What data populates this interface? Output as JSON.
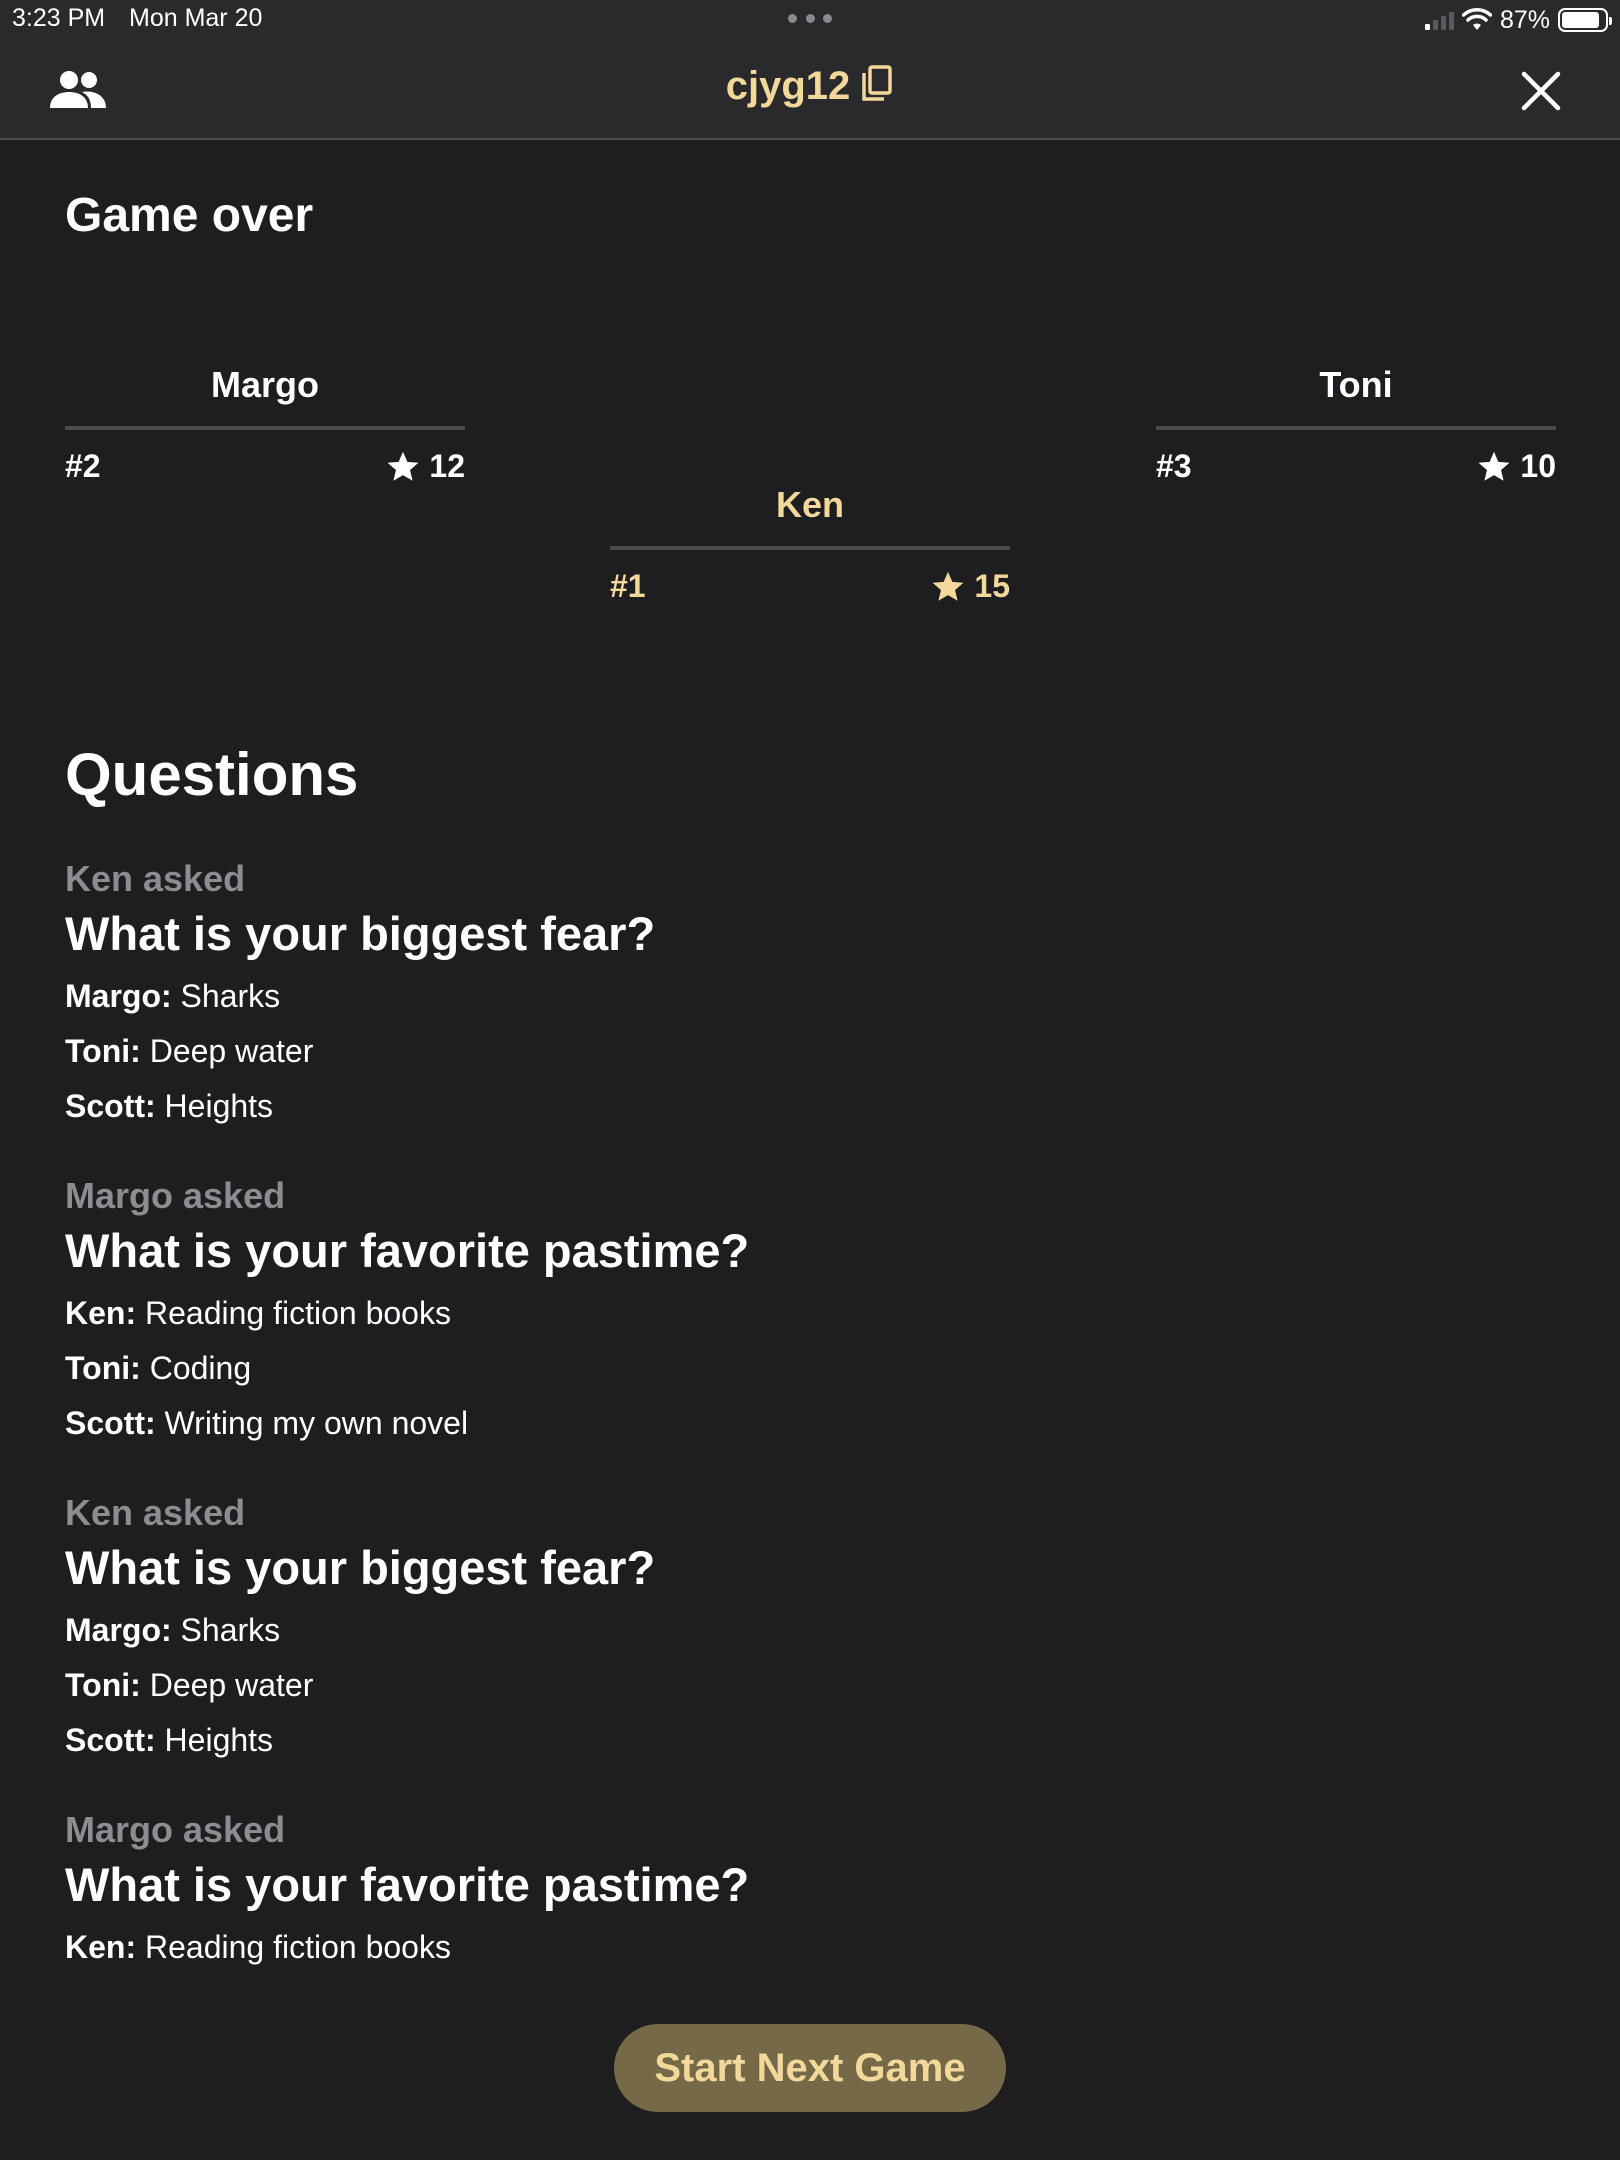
{
  "status_bar": {
    "time": "3:23 PM",
    "date": "Mon Mar 20",
    "battery": "87%",
    "battery_level": 0.87
  },
  "nav": {
    "room_code": "cjyg12",
    "people_icon": "people-icon",
    "copy_icon": "copy-icon",
    "close_icon": "close-icon"
  },
  "page_title": "Game over",
  "leaderboard": [
    {
      "name": "Margo",
      "rank": "#2",
      "score": "12",
      "highlight": false
    },
    {
      "name": "Ken",
      "rank": "#1",
      "score": "15",
      "highlight": true
    },
    {
      "name": "Toni",
      "rank": "#3",
      "score": "10",
      "highlight": false
    }
  ],
  "questions_title": "Questions",
  "questions": [
    {
      "asker": "Ken asked",
      "question": "What is your biggest fear?",
      "answers": [
        {
          "player": "Margo:",
          "answer": "Sharks"
        },
        {
          "player": "Toni:",
          "answer": "Deep water"
        },
        {
          "player": "Scott:",
          "answer": "Heights"
        }
      ]
    },
    {
      "asker": "Margo asked",
      "question": "What is your favorite pastime?",
      "answers": [
        {
          "player": "Ken:",
          "answer": "Reading fiction books"
        },
        {
          "player": "Toni:",
          "answer": "Coding"
        },
        {
          "player": "Scott:",
          "answer": "Writing my own novel"
        }
      ]
    },
    {
      "asker": "Ken asked",
      "question": "What is your biggest fear?",
      "answers": [
        {
          "player": "Margo:",
          "answer": "Sharks"
        },
        {
          "player": "Toni:",
          "answer": "Deep water"
        },
        {
          "player": "Scott:",
          "answer": "Heights"
        }
      ]
    },
    {
      "asker": "Margo asked",
      "question": "What is your favorite pastime?",
      "answers": [
        {
          "player": "Ken:",
          "answer": "Reading fiction books"
        }
      ]
    }
  ],
  "start_button_label": "Start Next Game",
  "colors": {
    "background": "#1e1e20",
    "bar": "#2a2a2c",
    "accent": "#f2d89a",
    "button": "#756947",
    "muted": "#8d8d91"
  }
}
